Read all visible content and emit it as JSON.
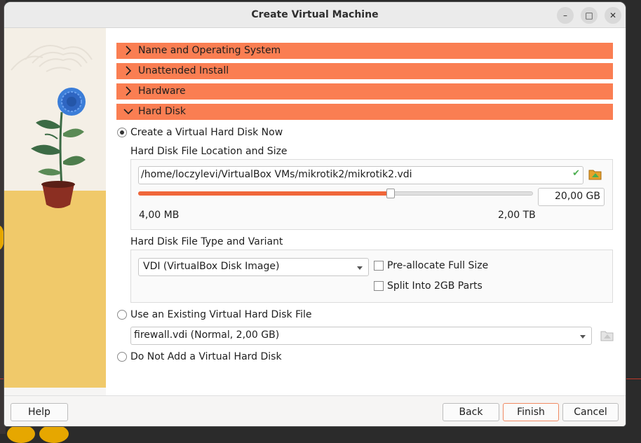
{
  "window": {
    "title": "Create Virtual Machine",
    "minimize_symbol": "–",
    "maximize_symbol": "□",
    "close_symbol": "✕"
  },
  "sections": {
    "name_os": "Name and Operating System",
    "unattended": "Unattended Install",
    "hardware": "Hardware",
    "hard_disk": "Hard Disk"
  },
  "hard_disk": {
    "option_create": "Create a Virtual Hard Disk Now",
    "location_size_label": "Hard Disk File Location and Size",
    "file_path": "/home/loczylevi/VirtualBox VMs/mikrotik2/mikrotik2.vdi",
    "size_value": "20,00 GB",
    "size_fraction": 0.64,
    "min_size": "4,00 MB",
    "max_size": "2,00 TB",
    "type_variant_label": "Hard Disk File Type and Variant",
    "disk_type": "VDI (VirtualBox Disk Image)",
    "preallocate_label": "Pre-allocate Full Size",
    "preallocate_checked": false,
    "split_label": "Split Into 2GB Parts",
    "split_checked": false,
    "option_existing": "Use an Existing Virtual Hard Disk File",
    "existing_file": "firewall.vdi (Normal, 2,00 GB)",
    "option_none": "Do Not Add a Virtual Hard Disk",
    "selected_option": "create"
  },
  "buttons": {
    "help": "Help",
    "back": "Back",
    "finish": "Finish",
    "cancel": "Cancel"
  },
  "colors": {
    "section_header": "#fa7e52",
    "accent_valid": "#4caf50"
  }
}
